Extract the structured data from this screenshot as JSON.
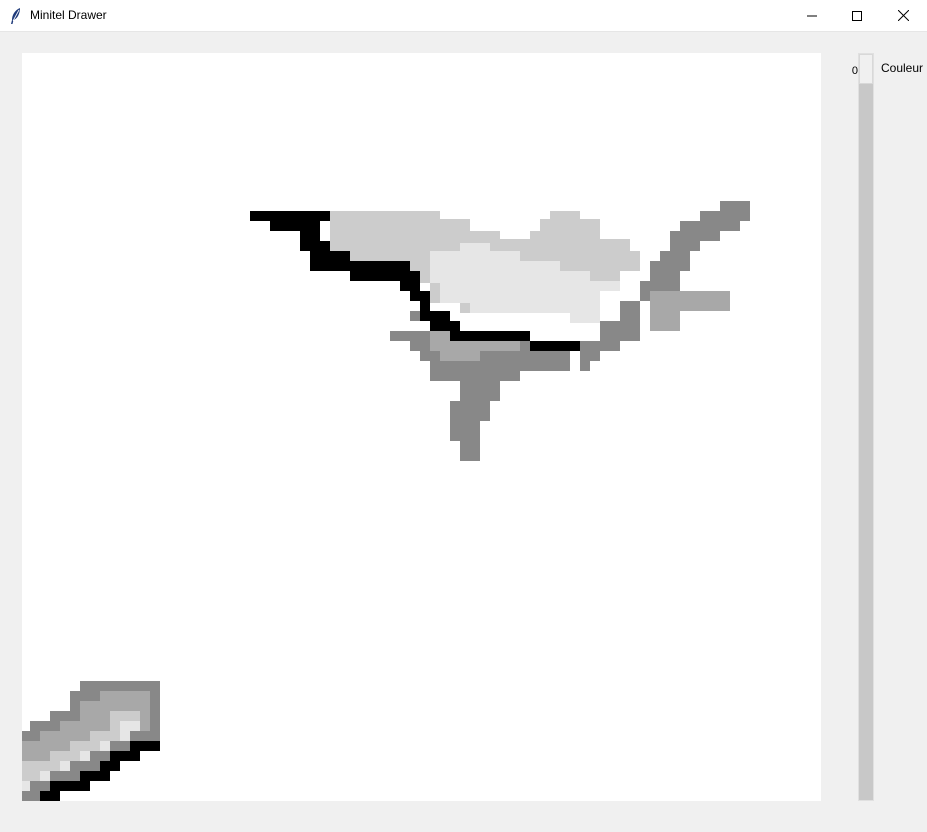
{
  "window": {
    "title": "Minitel Drawer",
    "icon": "feather-icon",
    "controls": [
      "minimize-icon",
      "maximize-icon",
      "close-icon"
    ]
  },
  "scale": {
    "label": "Couleur",
    "value": "0",
    "min": 0
  },
  "canvas": {
    "background": "#ffffff",
    "palette": [
      "#000000",
      "#888888",
      "#a8a8a8",
      "#cccccc",
      "#e6e6e6",
      "#ffffff"
    ]
  }
}
